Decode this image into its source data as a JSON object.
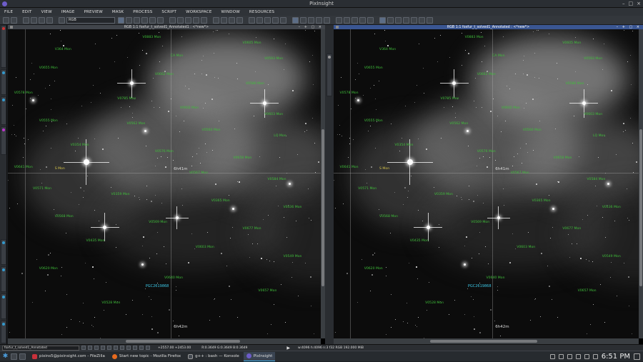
{
  "window": {
    "title": "PixInsight"
  },
  "menu": [
    "FILE",
    "EDIT",
    "VIEW",
    "IMAGE",
    "PREVIEW",
    "MASK",
    "PROCESS",
    "SCRIPT",
    "WORKSPACE",
    "WINDOW",
    "RESOURCES"
  ],
  "toolbar": {
    "channel_select": "RGB"
  },
  "left_view": {
    "title": "RGB 1:1 foxfur_t_solved1_Annotated1 : <*new*>",
    "grid_labels": {
      "ra_a": "6h41m",
      "ra_b": "6h42m"
    },
    "highlight_label": "S Mon",
    "galaxy_label": "PGC2619868",
    "star_labels": [
      "V0883 Mon",
      "V0605 Mon",
      "V364 Mon",
      "CA Mon",
      "V0593 Mon",
      "V0655 Mon",
      "V0662 Mon",
      "V0580 Mon",
      "V0578 Mon",
      "V0785 Mon",
      "V0602 Mon",
      "V0603 Mon",
      "V0555 Mon",
      "V0562 Mon",
      "V0560 Mon",
      "LQ Mon",
      "V0354 Mon",
      "V0576 Mon",
      "V0658 Mon",
      "V0641 Mon",
      "V0567 Mon",
      "V0584 Mon",
      "V0571 Mon",
      "V0359 Mon",
      "V0365 Mon",
      "V0436 Mon",
      "V0568 Mon",
      "V0569 Mon",
      "V0677 Mon",
      "V0435 Mon",
      "V0603 Mon",
      "V0549 Mon",
      "V0620 Mon",
      "V0640 Mon",
      "V0657 Mon",
      "V0528 Mon"
    ]
  },
  "right_view": {
    "title": "RGB 1:1 foxfur_t_solved1_Annotated : <*new*>",
    "grid_labels": {
      "ra_a": "6h41m",
      "ra_b": "6h42m"
    },
    "highlight_label": "S Mon",
    "galaxy_label": "PGC2619868",
    "star_labels": [
      "V0883 Mon",
      "V0605 Mon",
      "V364 Mon",
      "CA Mon",
      "V0593 Mon",
      "V0655 Mon",
      "V0662 Mon",
      "V0580 Mon",
      "V0578 Mon",
      "V0785 Mon",
      "V0602 Mon",
      "V0603 Mon",
      "V0555 Mon",
      "V0562 Mon",
      "V0560 Mon",
      "LQ Mon",
      "V0354 Mon",
      "V0576 Mon",
      "V0658 Mon",
      "V0641 Mon",
      "V0567 Mon",
      "V0584 Mon",
      "V0571 Mon",
      "V0359 Mon",
      "V0365 Mon",
      "V0436 Mon",
      "V0568 Mon",
      "V0569 Mon",
      "V0677 Mon",
      "V0435 Mon",
      "V0603 Mon",
      "V0549 Mon",
      "V0620 Mon",
      "V0640 Mon",
      "V0657 Mon",
      "V0528 Mon"
    ]
  },
  "status": {
    "view_select": "foxfur_t_solved1_Annotated",
    "coords_left": "+2557.00   +2453.00",
    "values_left": "R:0.3649   G:0.3649   B:0.3649",
    "info_right": "w:4096   h:4096   n:3   f32   RGB   192.000 MiB"
  },
  "taskbar": {
    "tasks": [
      {
        "label": "pixins5@pixinsight.com - FileZilla",
        "color": "#c8313b"
      },
      {
        "label": "Start new topic - Mozilla Firefox",
        "color": "#e66a1e"
      },
      {
        "label": "g++ : bash — Konsole",
        "color": "#444a52"
      },
      {
        "label": "PixInsight",
        "color": "#6d5cc9"
      }
    ],
    "clock": "6:51 PM"
  }
}
